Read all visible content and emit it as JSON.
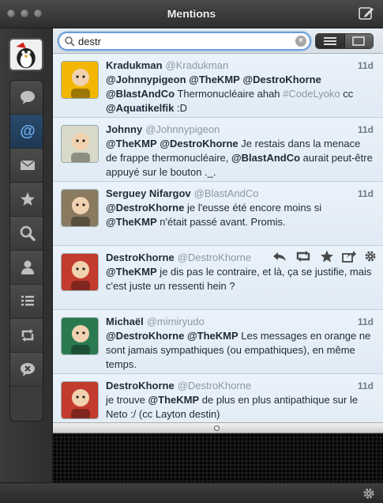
{
  "window": {
    "title": "Mentions"
  },
  "search": {
    "value": "destr",
    "placeholder": ""
  },
  "sidebar": {
    "items": [
      {
        "name": "messages",
        "icon": "speech-bubble-icon"
      },
      {
        "name": "mentions",
        "icon": "at-icon",
        "active": true
      },
      {
        "name": "direct-messages",
        "icon": "envelope-icon"
      },
      {
        "name": "favorites",
        "icon": "star-icon"
      },
      {
        "name": "search",
        "icon": "search-icon"
      },
      {
        "name": "profile",
        "icon": "person-icon"
      },
      {
        "name": "lists",
        "icon": "list-icon"
      },
      {
        "name": "retweets",
        "icon": "retweet-icon"
      },
      {
        "name": "mutes",
        "icon": "mute-bubble-icon"
      }
    ]
  },
  "tweets": [
    {
      "name": "Kradukman",
      "handle": "@Kradukman",
      "time": "11d",
      "avatar_color": "#f2b705",
      "segments": [
        {
          "t": "@Johnnypigeon",
          "b": true
        },
        {
          "t": " "
        },
        {
          "t": "@TheKMP",
          "b": true
        },
        {
          "t": " "
        },
        {
          "t": "@DestroKhorne",
          "b": true
        },
        {
          "t": " "
        },
        {
          "t": "@BlastAndCo",
          "b": true
        },
        {
          "t": " Thermonucléaire ahah "
        },
        {
          "t": "#CodeLyoko",
          "tag": true
        },
        {
          "t": " cc "
        },
        {
          "t": "@Aquatikelfik",
          "b": true
        },
        {
          "t": " :D"
        }
      ]
    },
    {
      "name": "Johnny",
      "handle": "@Johnnypigeon",
      "time": "11d",
      "avatar_color": "#d9d9c8",
      "segments": [
        {
          "t": "@TheKMP",
          "b": true
        },
        {
          "t": " "
        },
        {
          "t": "@DestroKhorne",
          "b": true
        },
        {
          "t": " Je restais dans la menace de frappe thermonucléaire, "
        },
        {
          "t": "@BlastAndCo",
          "b": true
        },
        {
          "t": " aurait peut-être appuyé sur le bouton ._."
        }
      ]
    },
    {
      "name": "Serguey Nifargov",
      "handle": "@BlastAndCo",
      "time": "11d",
      "avatar_color": "#8a7a60",
      "segments": [
        {
          "t": "@DestroKhorne",
          "b": true
        },
        {
          "t": " je l'eusse été encore moins si "
        },
        {
          "t": "@TheKMP",
          "b": true
        },
        {
          "t": " n'était passé avant. Promis."
        }
      ]
    },
    {
      "name": "DestroKhorne",
      "handle": "@DestroKhorne",
      "time": "",
      "avatar_color": "#c33b2e",
      "hover": true,
      "segments": [
        {
          "t": "@TheKMP",
          "b": true
        },
        {
          "t": " je dis pas le contraire, et là, ça se justifie, mais c'est juste un ressenti hein ?"
        }
      ]
    },
    {
      "name": "Michaël",
      "handle": "@mimiryudo",
      "time": "11d",
      "avatar_color": "#2a7a50",
      "segments": [
        {
          "t": "@DestroKhorne",
          "b": true
        },
        {
          "t": " "
        },
        {
          "t": "@TheKMP",
          "b": true
        },
        {
          "t": " Les messages en orange ne sont jamais sympathiques (ou empathiques), en même temps."
        }
      ]
    },
    {
      "name": "DestroKhorne",
      "handle": "@DestroKhorne",
      "time": "11d",
      "avatar_color": "#c33b2e",
      "segments": [
        {
          "t": "je trouve "
        },
        {
          "t": "@TheKMP",
          "b": true
        },
        {
          "t": " de plus en plus antipathique sur le Neto :/ (cc Layton destin)"
        }
      ]
    }
  ],
  "colors": {
    "mention": "#1d2a36",
    "hashtag": "#8a98a6",
    "accent": "#6aa0d8"
  }
}
